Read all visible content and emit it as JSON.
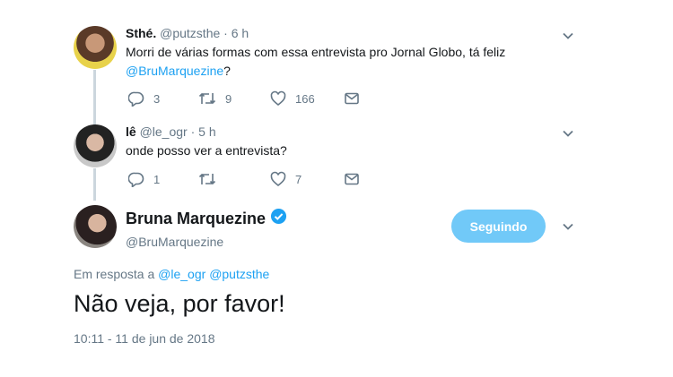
{
  "tweet1": {
    "name": "Sthé.",
    "handle": "@putzsthe",
    "time": "· 6 h",
    "text_line1": "Morri de várias formas com essa entrevista pro Jornal Globo, tá feliz",
    "text_mention": "@BruMarquezine",
    "text_suffix": "?",
    "replies": "3",
    "retweets": "9",
    "likes": "166"
  },
  "tweet2": {
    "name": "lê",
    "handle": "@le_ogr",
    "time": "· 5 h",
    "text": "onde posso ver a entrevista?",
    "replies": "1",
    "retweets": "",
    "likes": "7"
  },
  "main_tweet": {
    "name": "Bruna Marquezine",
    "handle": "@BruMarquezine",
    "follow_label": "Seguindo",
    "reply_prefix": "Em resposta a",
    "reply_to_1": "@le_ogr",
    "reply_to_2": "@putzsthe",
    "text": "Não veja, por favor!",
    "timestamp": "10:11 - 11 de jun de 2018"
  },
  "icons": {
    "reply": "reply-icon",
    "retweet": "retweet-icon",
    "like": "heart-icon",
    "dm": "envelope-icon",
    "menu": "chevron-down-icon",
    "verified": "verified-badge-icon"
  },
  "colors": {
    "accent": "#1da1f2",
    "follow_button": "#71c9f8",
    "muted_text": "#657786",
    "thread_line": "#ccd6dd"
  }
}
